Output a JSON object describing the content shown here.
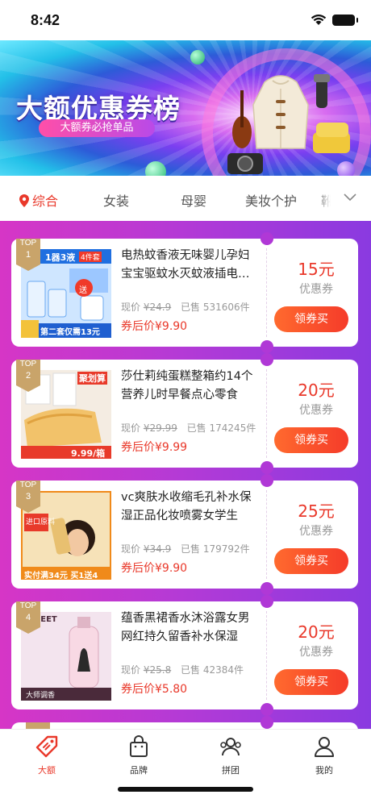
{
  "status_bar": {
    "time": "8:42"
  },
  "banner": {
    "title": "大额优惠券榜",
    "subtitle": "大额券必抢单品"
  },
  "tabs": [
    {
      "label": "综合",
      "active": true
    },
    {
      "label": "女装",
      "active": false
    },
    {
      "label": "母婴",
      "active": false
    },
    {
      "label": "美妆个护",
      "active": false
    },
    {
      "label": "靴",
      "active": false
    }
  ],
  "labels": {
    "orig_price_prefix": "现价",
    "sold_prefix": "已售",
    "after_coupon_prefix": "券后价",
    "coupon_label": "优惠券",
    "buy_button": "领券买",
    "top_badge": "TOP"
  },
  "products": [
    {
      "rank": "1",
      "name": "电热蚊香液无味婴儿孕妇宝宝驱蚊水灭蚊液插电式家用补充",
      "original_price": "¥24.9",
      "sold": "531606件",
      "after_price": "¥9.90",
      "coupon": "15元",
      "thumb_text": {
        "top": "1器3液",
        "tag": "4件套",
        "bottom": "第二套仅需13元",
        "corner": "送"
      }
    },
    {
      "rank": "2",
      "name": "莎仕莉纯蛋糕整箱约14个营养儿时早餐点心零食",
      "original_price": "¥29.99",
      "sold": "174245件",
      "after_price": "¥9.99",
      "coupon": "20元",
      "thumb_text": {
        "top": "聚划算",
        "bottom": "9.99/箱"
      }
    },
    {
      "rank": "3",
      "name": "vc爽肤水收缩毛孔补水保湿正品化妆喷雾女学生",
      "original_price": "¥34.9",
      "sold": "179792件",
      "after_price": "¥9.90",
      "coupon": "25元",
      "thumb_text": {
        "top": "进口原料",
        "bottom": "实付满34元 买1送4"
      }
    },
    {
      "rank": "4",
      "name": "蕴香黑裙香水沐浴露女男网红持久留香补水保湿",
      "original_price": "¥25.8",
      "sold": "42384件",
      "after_price": "¥5.80",
      "coupon": "20元",
      "thumb_text": {
        "top": "SWEET",
        "bottom": "大师调香"
      }
    }
  ],
  "nav": [
    {
      "label": "大额",
      "icon": "coupon-tag-icon",
      "active": true
    },
    {
      "label": "品牌",
      "icon": "shopping-bag-icon",
      "active": false
    },
    {
      "label": "拼团",
      "icon": "group-people-icon",
      "active": false
    },
    {
      "label": "我的",
      "icon": "person-icon",
      "active": false
    }
  ],
  "colors": {
    "accent": "#e9382a",
    "list_bg_left": "#d636c6",
    "list_bg_right": "#8a3ae0",
    "button": "#f53b2a"
  }
}
